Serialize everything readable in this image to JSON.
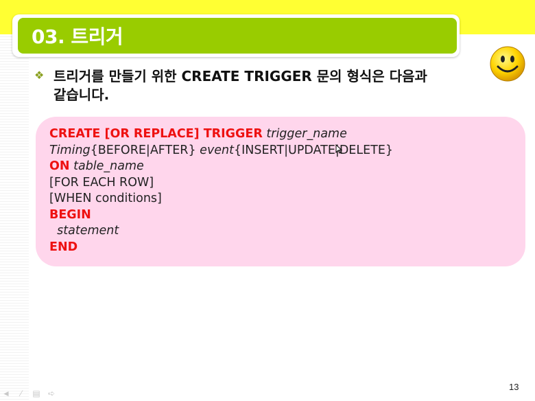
{
  "slide": {
    "title": "03. 트리거",
    "bullet": {
      "icon": "diamond-bullet-icon",
      "line1": "트리거를 만들기 위한 CREATE TRIGGER 문의 형식은 다음과",
      "line2": "같습니다."
    },
    "decoration": "smiley-face-icon",
    "page_number": "13"
  },
  "code": {
    "line1": {
      "kw": "CREATE [OR REPLACE] TRIGGER",
      "it": "trigger_name"
    },
    "line2": {
      "it1": "Timing",
      "pl1": "{BEFORE|AFTER}",
      "it2": "event",
      "pl2": "{INSERT|UPDATE|DELETE}"
    },
    "line3": {
      "kw": "ON",
      "it": "table_name"
    },
    "line4": "[FOR EACH ROW]",
    "line5": "[WHEN conditions]",
    "line6": "BEGIN",
    "line7": "statement",
    "line8": "END"
  },
  "colors": {
    "header_band": "#ffff33",
    "title_bar": "#99cc00",
    "code_background": "#ffd6ec",
    "keyword": "#ee1111"
  },
  "nav_icons": [
    "previous-arrow-icon",
    "next-arrow-icon",
    "menu-icon",
    "end-arrow-icon"
  ]
}
